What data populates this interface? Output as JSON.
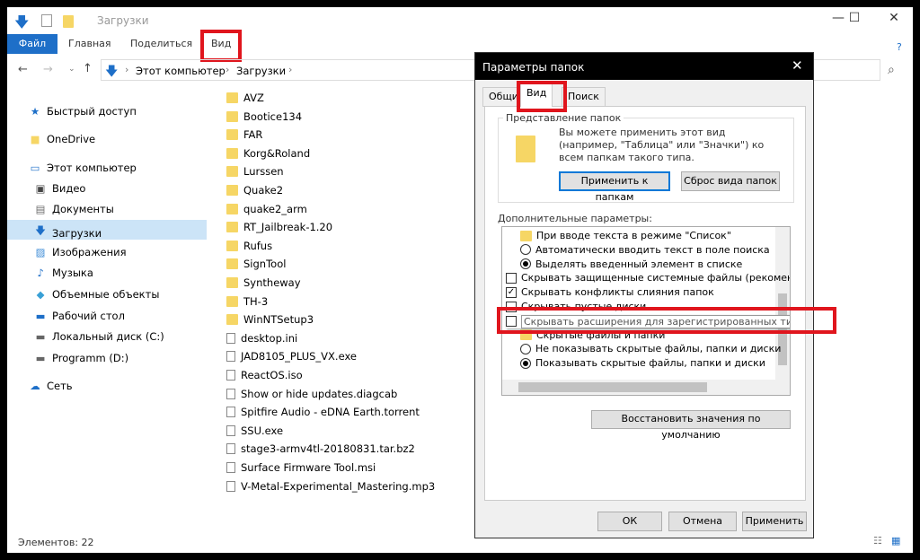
{
  "window": {
    "title": "Загрузки",
    "minimize": "—",
    "maximize": "☐",
    "close": "✕"
  },
  "ribbon": {
    "tabs": [
      "Файл",
      "Главная",
      "Поделиться",
      "Вид"
    ],
    "help": "?"
  },
  "address": {
    "path": [
      "Этот компьютер",
      "Загрузки"
    ],
    "search_icon": "⌕"
  },
  "sidebar": {
    "items": [
      {
        "label": "Быстрый доступ",
        "icon": "star-icon"
      },
      {
        "label": "OneDrive",
        "icon": "folder-icon"
      },
      {
        "label": "Этот компьютер",
        "icon": "computer-icon"
      },
      {
        "label": "Видео",
        "icon": "video-icon"
      },
      {
        "label": "Документы",
        "icon": "documents-icon"
      },
      {
        "label": "Загрузки",
        "icon": "download-icon",
        "selected": true
      },
      {
        "label": "Изображения",
        "icon": "pictures-icon"
      },
      {
        "label": "Музыка",
        "icon": "music-icon"
      },
      {
        "label": "Объемные объекты",
        "icon": "3d-objects-icon"
      },
      {
        "label": "Рабочий стол",
        "icon": "desktop-icon"
      },
      {
        "label": "Локальный диск (C:)",
        "icon": "drive-icon"
      },
      {
        "label": "Programm (D:)",
        "icon": "drive-icon"
      },
      {
        "label": "Сеть",
        "icon": "network-icon"
      }
    ]
  },
  "files": [
    "AVZ",
    "Bootice134",
    "FAR",
    "Korg&Roland",
    "Lurssen",
    "Quake2",
    "quake2_arm",
    "RT_Jailbreak-1.20",
    "Rufus",
    "SignTool",
    "Syntheway",
    "TH-3",
    "WinNTSetup3",
    "desktop.ini",
    "JAD8105_PLUS_VX.exe",
    "ReactOS.iso",
    "Show or hide updates.diagcab",
    "Spitfire Audio - eDNA Earth.torrent",
    "SSU.exe",
    "stage3-armv4tl-20180831.tar.bz2",
    "Surface Firmware Tool.msi",
    "V-Metal-Experimental_Mastering.mp3"
  ],
  "folder_count": 13,
  "status": {
    "items": "Элементов: 22"
  },
  "dialog": {
    "title": "Параметры папок",
    "close": "✕",
    "tabs": [
      "Общие",
      "Вид",
      "Поиск"
    ],
    "group_title": "Представление папок",
    "group_text": "Вы можете применить этот вид (например, \"Таблица\" или \"Значки\") ко всем папкам такого типа.",
    "apply_folders": "Применить к папкам",
    "reset_folders": "Сброс вида папок",
    "advanced_label": "Дополнительные параметры:",
    "options": [
      {
        "type": "folder",
        "label": "При вводе текста в режиме \"Список\""
      },
      {
        "type": "radio",
        "checked": false,
        "label": "Автоматически вводить текст в поле поиска"
      },
      {
        "type": "radio",
        "checked": true,
        "label": "Выделять введенный элемент в списке"
      },
      {
        "type": "checkbox",
        "checked": false,
        "label": "Скрывать защищенные системные файлы (рекомен,"
      },
      {
        "type": "checkbox",
        "checked": true,
        "label": "Скрывать конфликты слияния папок"
      },
      {
        "type": "checkbox",
        "checked": false,
        "label": "Скрывать пустые диски"
      },
      {
        "type": "checkbox",
        "checked": false,
        "label": "Скрывать расширения для зарегистрированных типов файлов"
      },
      {
        "type": "folder",
        "label": "Скрытые файлы и папки"
      },
      {
        "type": "radio",
        "checked": false,
        "label": "Не показывать скрытые файлы, папки и диски"
      },
      {
        "type": "radio",
        "checked": true,
        "label": "Показывать скрытые файлы, папки и диски"
      }
    ],
    "restore": "Восстановить значения по умолчанию",
    "ok": "ОК",
    "cancel": "Отмена",
    "apply": "Применить"
  },
  "colors": {
    "accent": "#1e6fc8",
    "highlight": "#e0151d",
    "selection": "#cce4f7"
  }
}
